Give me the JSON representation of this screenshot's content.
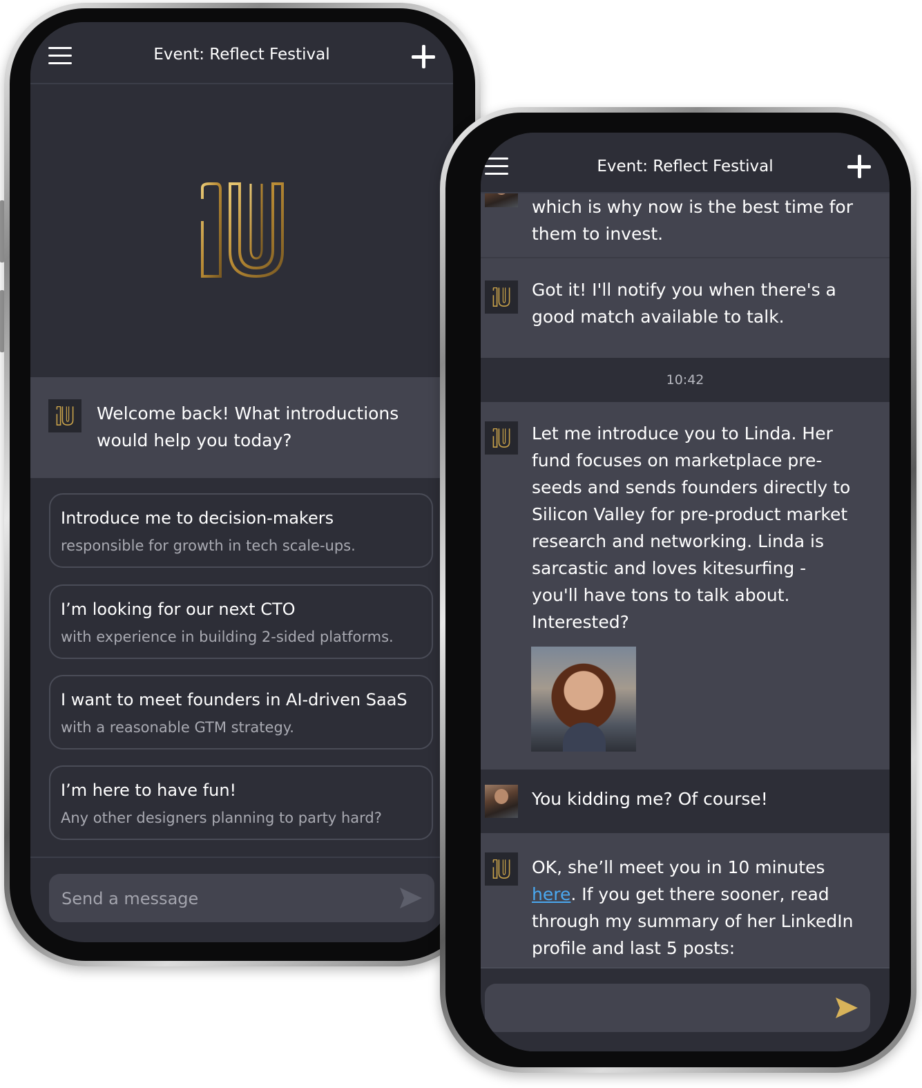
{
  "phone_left": {
    "header": {
      "title": "Event: Reflect Festival"
    },
    "welcome": {
      "text": "Welcome back! What introductions would help you today?"
    },
    "prompts": [
      {
        "main": "Introduce me to decision-makers",
        "sub": "responsible for growth in tech scale-ups."
      },
      {
        "main": "I’m looking for our next CTO",
        "sub": "with experience in building 2-sided platforms."
      },
      {
        "main": "I want to meet founders in AI-driven SaaS",
        "sub": "with a reasonable GTM strategy."
      },
      {
        "main": "I’m here to have fun!",
        "sub": "Any other designers planning to party hard?"
      }
    ],
    "composer": {
      "placeholder": "Send a message"
    }
  },
  "phone_right": {
    "header": {
      "title": "Event: Reflect Festival"
    },
    "messages": {
      "m1": "which is why now is the best time for them to invest.",
      "m2": "Got it! I'll notify you when there's a good match available to talk.",
      "time": "10:42",
      "m3": "Let me introduce you to Linda. Her fund focuses on marketplace pre-seeds and sends founders directly to Silicon Valley for pre-product market research and networking. Linda is sarcastic and loves kitesurfing - you'll have tons to talk about. Interested?",
      "m4": "You kidding me? Of course!",
      "m5_before": "OK, she’ll meet you in 10 minutes ",
      "m5_link": "here",
      "m5_after": ". If you get there sooner, read through my summary of her LinkedIn profile and last 5 posts:"
    }
  },
  "icons": {
    "menu": "hamburger-menu-icon",
    "add": "plus-icon",
    "send": "send-arrow-icon",
    "logo": "au-monogram-logo"
  },
  "colors": {
    "background": "#2d2e37",
    "highlight_row": "#43444f",
    "logo_gold": "#c9a24a",
    "send_active": "#d8b35a",
    "link": "#4aa8f0"
  }
}
